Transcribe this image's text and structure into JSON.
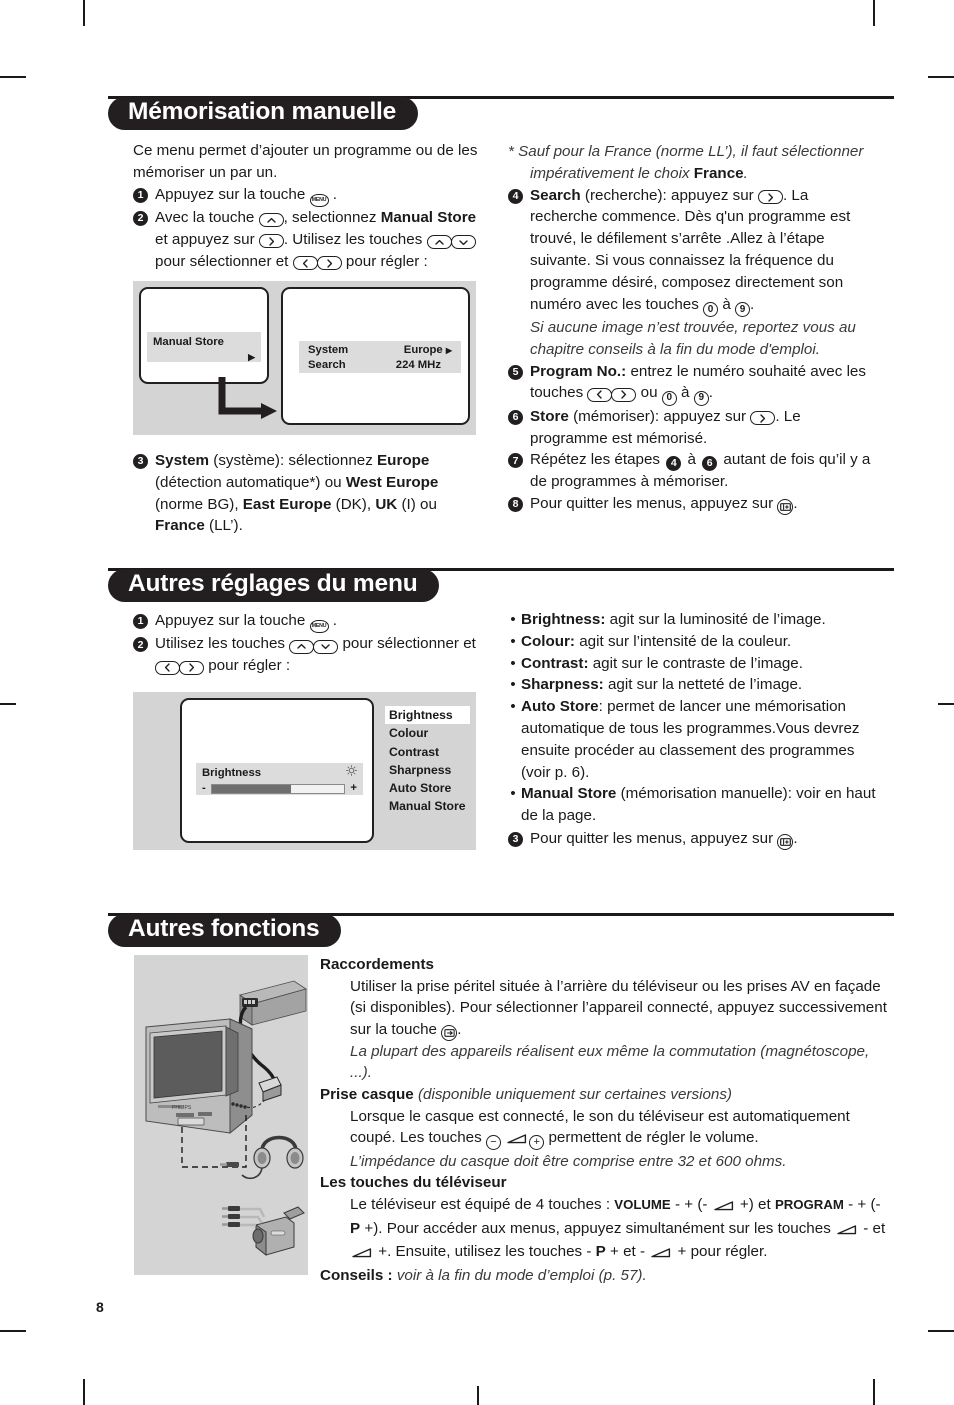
{
  "page": {
    "number": "8"
  },
  "sections": [
    {
      "id": "manual_store",
      "title": "Mémorisation manuelle"
    },
    {
      "id": "other_menu",
      "title": "Autres réglages du menu"
    },
    {
      "id": "other_functions",
      "title": "Autres fonctions"
    }
  ],
  "manual_store": {
    "intro": "Ce menu permet d’ajouter un programme ou de les mémoriser un par un.",
    "step1": {
      "pre": "Appuyez sur la touche",
      "post": "."
    },
    "step2": {
      "a": "Avec la touche",
      "b": ", selectionnez",
      "bold": "Manual Store",
      "c": "et appuyez sur",
      "d": ". Utilisez les touches",
      "e": "pour sélectionner et",
      "f": "pour régler :"
    },
    "step3": {
      "bold1": "System",
      "a": "(système): sélectionnez",
      "bold2": "Europe",
      "b": "(détection automatique*) ou",
      "bold3": "West Europe",
      "c": "(norme BG),",
      "bold4": "East Europe",
      "d": "(DK),",
      "bold5": "UK",
      "e": "(I) ou",
      "bold6": "France",
      "f": "(LL’)."
    },
    "footnote": {
      "a": "* Sauf pour la France (norme LL’), il faut sélectionner impérativement le choix",
      "bold": "France",
      "b": "."
    },
    "step4": {
      "bold": "Search",
      "a": "(recherche): appuyez sur",
      "b": ". La recherche commence. Dès q'un programme est trouvé, le défilement s’arrête .Allez à l’étape suivante. Si vous connaissez la fréquence du programme désiré, composez directement son numéro avec les touches",
      "key0": "0",
      "c": "à",
      "key9": "9",
      "d": ".",
      "italic": "Si aucune image n’est trouvée, reportez vous au chapitre conseils à la fin du mode d'emploi."
    },
    "step5": {
      "bold": "Program No.:",
      "a": "entrez le numéro souhaité avec les touches",
      "b": "ou",
      "key0": "0",
      "c": "à",
      "key9": "9",
      "d": "."
    },
    "step6": {
      "bold": "Store",
      "a": "(mémoriser): appuyez sur",
      "b": ". Le programme est mémorisé."
    },
    "step7": {
      "a": "Répétez les étapes",
      "n1": "4",
      "b": "à",
      "n2": "6",
      "c": "autant de fois qu’il y a de programmes à mémoriser."
    },
    "step8": {
      "a": "Pour quitter les menus, appuyez sur",
      "b": "."
    },
    "diagram": {
      "left_menu_label": "Manual Store",
      "right_rows": [
        {
          "label": "System",
          "value": "Europe",
          "arrow": true
        },
        {
          "label": "Search",
          "value": "224 MHz",
          "arrow": false
        }
      ]
    }
  },
  "other_menu": {
    "step1": {
      "pre": "Appuyez sur la touche",
      "post": "."
    },
    "step2": {
      "a": "Utilisez les touches",
      "b": "pour sélectionner et",
      "c": "pour régler :"
    },
    "bullets": [
      {
        "bold": "Brightness:",
        "text": "agit sur la luminosité de l’image."
      },
      {
        "bold": "Colour:",
        "text": "agit sur l’intensité de la couleur."
      },
      {
        "bold": "Contrast:",
        "text": "agit sur le contraste de l’image."
      },
      {
        "bold": "Sharpness:",
        "text": "agit sur la netteté de l’image."
      },
      {
        "bold": "Auto Store",
        "text": ": permet de lancer une mémorisation automatique de tous les programmes.Vous devrez ensuite procéder au classement des programmes (voir p. 6)."
      },
      {
        "bold": "Manual Store",
        "text": "(mémorisation manuelle): voir en haut de la page."
      }
    ],
    "step3": {
      "a": "Pour quitter les menus, appuyez sur",
      "b": "."
    },
    "diagram": {
      "osd_title": "Brightness",
      "minus": "-",
      "plus": "+",
      "slider_percent": 60,
      "menu_items": [
        "Brightness",
        "Colour",
        "Contrast",
        "Sharpness",
        "Auto Store",
        "Manual Store"
      ],
      "selected_item": "Brightness"
    }
  },
  "other_functions": {
    "raccordements": {
      "heading": "Raccordements",
      "p1a": "Utiliser la prise péritel située à l’arrière du téléviseur ou les prises AV en façade (si disponibles). Pour sélectionner l’appareil connecté, appuyez successivement sur la touche",
      "p1b": ".",
      "note": "La plupart des appareils réalisent eux même la commutation (magnétoscope, ...)."
    },
    "prise_casque": {
      "heading": "Prise casque",
      "heading_note": "(disponible uniquement sur certaines versions)",
      "p1a": "Lorsque le casque est connecté, le son du téléviseur est automatiquement coupé. Les touches",
      "minus": "−",
      "plus": "+",
      "p1b": "permettent de régler le volume.",
      "note": "L’impédance du casque doit être comprise entre 32 et 600 ohms."
    },
    "touches": {
      "heading": "Les touches du téléviseur",
      "a": "Le téléviseur est équipé de 4 touches :",
      "volume": "VOLUME",
      "b": "- + (-",
      "c": "+) et",
      "program": "PROGRAM",
      "d": "- + (-",
      "p1": "P",
      "e": "+). Pour accéder aux menus, appuyez simultanément sur les touches",
      "f": "- et",
      "g": "+. Ensuite, utilisez les touches -",
      "p2": "P",
      "h": "+ et -",
      "i": "+ pour régler."
    },
    "conseils": {
      "heading": "Conseils :",
      "text": "voir à la fin du mode d’emploi (p. 57)."
    }
  },
  "colors": {
    "pill_bg": "#231f20",
    "panel_gray": "#d4d4d4",
    "osd_gray": "#dcdcdc"
  }
}
